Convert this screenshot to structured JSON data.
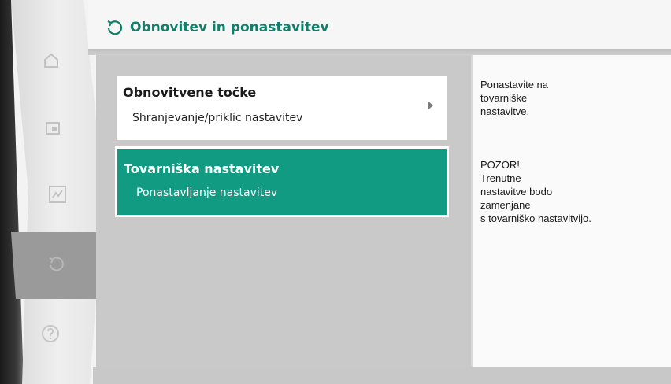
{
  "header": {
    "title": "Obnovitev in ponastavitev",
    "icon": "restore-icon",
    "accent_color": "#0f7f6a"
  },
  "sidebar": {
    "items": [
      {
        "icon": "home-icon",
        "selected": false
      },
      {
        "icon": "settings-icon",
        "selected": false
      },
      {
        "icon": "diagnostics-icon",
        "selected": false
      },
      {
        "icon": "restore-icon",
        "selected": true
      },
      {
        "icon": "help-icon",
        "selected": false
      }
    ]
  },
  "menu": {
    "items": [
      {
        "title": "Obnovitvene točke",
        "subtitle": "Shranjevanje/priklic nastavitev",
        "selected": false
      },
      {
        "title": "Tovarniška nastavitev",
        "subtitle": "Ponastavljanje nastavitev",
        "selected": true,
        "color": "#109b82"
      }
    ]
  },
  "info": {
    "lines_1": "Ponastavite na\ntovarniške\nnastavitve.",
    "lines_2": "POZOR!\nTrenutne\nnastavitve bodo\nzamenjane\ns tovarniško nastavitvijo."
  }
}
